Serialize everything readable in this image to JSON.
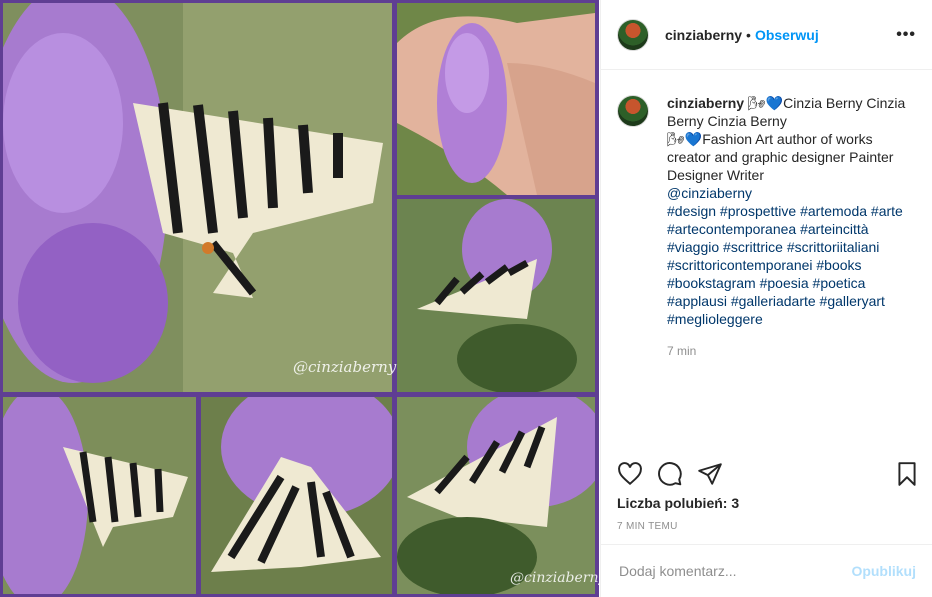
{
  "post": {
    "username": "cinziaberny",
    "dot": "•",
    "follow_label": "Obserwuj",
    "more_label": "•••"
  },
  "caption": {
    "username": "cinziaberny",
    "lines": [
      "🌬💙Cinzia Berny Cinzia",
      "Berny Cinzia Berny",
      "🌬💙Fashion Art author of works",
      "creator and graphic designer Painter",
      "Designer Writer"
    ],
    "mention": "@cinziaberny",
    "hashtag_lines": [
      "#design #prospettive #artemoda #arte",
      "#artecontemporanea #arteincittà",
      "#viaggio #scrittrice #scrittoriitaliani",
      "#scrittoricontemporanei #books",
      "#bookstagram #poesia #poetica",
      "#applausi #galleriadarte #galleryart",
      "#meglioleggere"
    ],
    "time": "7 min"
  },
  "icons": {
    "like": "heart-icon",
    "comment": "comment-icon",
    "share": "share-icon",
    "save": "bookmark-icon"
  },
  "likes_text": "Liczba polubień: 3",
  "time_ago": "7 MIN TEMU",
  "comment": {
    "placeholder": "Dodaj komentarz...",
    "post_label": "Opublikuj"
  },
  "watermark": "@cinziaberny",
  "colors": {
    "frame": "#5f3e93",
    "link": "#00376b",
    "follow": "#0095f6",
    "post_button_disabled": "#b2dffc"
  }
}
